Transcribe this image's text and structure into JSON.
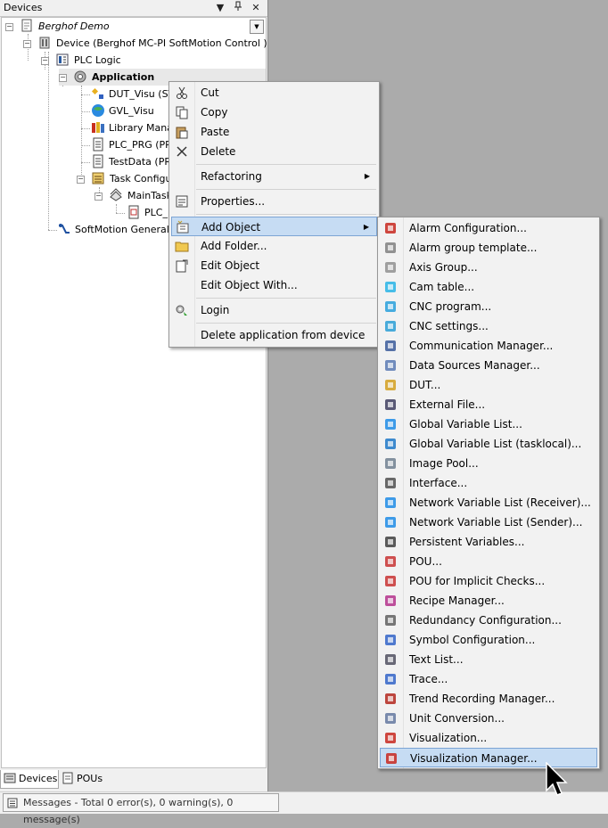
{
  "panel": {
    "title": "Devices",
    "buttons": {
      "dropdown": "▼",
      "pin": "ꟷ",
      "close": "✕"
    }
  },
  "tree": {
    "project": "Berghof Demo",
    "device": "Device (Berghof MC-PI SoftMotion Control )",
    "plc_logic": "PLC Logic",
    "application": "Application",
    "dut_visu": "DUT_Visu (STR",
    "gvl_visu": "GVL_Visu",
    "library_manager": "Library Manag",
    "plc_prg": "PLC_PRG (PRG",
    "testdata": "TestData (PRG",
    "task_configuration": "Task Configur",
    "maintask": "MainTask",
    "plc_p": "PLC_P",
    "softmotion": "SoftMotion General Ax"
  },
  "bottom_tabs": [
    {
      "label": "Devices",
      "icon": "devices-icon"
    },
    {
      "label": "POUs",
      "icon": "pous-icon"
    }
  ],
  "status": {
    "messages": "Messages - Total 0 error(s), 0 warning(s), 0 message(s)"
  },
  "context_menu": {
    "cut": "Cut",
    "copy": "Copy",
    "paste": "Paste",
    "delete": "Delete",
    "refactoring": "Refactoring",
    "properties": "Properties...",
    "add_object": "Add Object",
    "add_folder": "Add Folder...",
    "edit_object": "Edit Object",
    "edit_object_with": "Edit Object With...",
    "login": "Login",
    "delete_app": "Delete application from device"
  },
  "submenu": [
    {
      "label": "Alarm Configuration...",
      "icon": "alarm-configuration-icon",
      "color": "#c8281e"
    },
    {
      "label": "Alarm group template...",
      "icon": "alarm-group-icon",
      "color": "#808080"
    },
    {
      "label": "Axis Group...",
      "icon": "axis-group-icon",
      "color": "#909090"
    },
    {
      "label": "Cam table...",
      "icon": "cam-table-icon",
      "color": "#28b4e6"
    },
    {
      "label": "CNC program...",
      "icon": "cnc-program-icon",
      "color": "#28a0dc"
    },
    {
      "label": "CNC settings...",
      "icon": "cnc-settings-icon",
      "color": "#2a9fd6"
    },
    {
      "label": "Communication Manager...",
      "icon": "communication-manager-icon",
      "color": "#3a5a9a"
    },
    {
      "label": "Data Sources Manager...",
      "icon": "data-sources-icon",
      "color": "#5a7ab4"
    },
    {
      "label": "DUT...",
      "icon": "dut-icon",
      "color": "#d4a020"
    },
    {
      "label": "External File...",
      "icon": "external-file-icon",
      "color": "#404060"
    },
    {
      "label": "Global Variable List...",
      "icon": "global-variable-list-icon",
      "color": "#1e8ce6"
    },
    {
      "label": "Global Variable List (tasklocal)...",
      "icon": "gvl-tasklocal-icon",
      "color": "#1e78c8"
    },
    {
      "label": "Image Pool...",
      "icon": "image-pool-icon",
      "color": "#708090"
    },
    {
      "label": "Interface...",
      "icon": "interface-icon",
      "color": "#505050"
    },
    {
      "label": "Network Variable List (Receiver)...",
      "icon": "nvl-receiver-icon",
      "color": "#1e8ce6"
    },
    {
      "label": "Network Variable List (Sender)...",
      "icon": "nvl-sender-icon",
      "color": "#1e8ce6"
    },
    {
      "label": "Persistent Variables...",
      "icon": "persistent-variables-icon",
      "color": "#404040"
    },
    {
      "label": "POU...",
      "icon": "pou-icon",
      "color": "#c83232"
    },
    {
      "label": "POU for Implicit Checks...",
      "icon": "pou-implicit-icon",
      "color": "#c83232"
    },
    {
      "label": "Recipe Manager...",
      "icon": "recipe-manager-icon",
      "color": "#b4328c"
    },
    {
      "label": "Redundancy Configuration...",
      "icon": "redundancy-icon",
      "color": "#606060"
    },
    {
      "label": "Symbol Configuration...",
      "icon": "symbol-configuration-icon",
      "color": "#3264c8"
    },
    {
      "label": "Text List...",
      "icon": "text-list-icon",
      "color": "#505060"
    },
    {
      "label": "Trace...",
      "icon": "trace-icon",
      "color": "#3264c8"
    },
    {
      "label": "Trend Recording Manager...",
      "icon": "trend-recording-icon",
      "color": "#b4281e"
    },
    {
      "label": "Unit Conversion...",
      "icon": "unit-conversion-icon",
      "color": "#6478a0"
    },
    {
      "label": "Visualization...",
      "icon": "visualization-icon",
      "color": "#c8281e"
    },
    {
      "label": "Visualization Manager...",
      "icon": "visualization-manager-icon",
      "color": "#c8281e"
    }
  ]
}
